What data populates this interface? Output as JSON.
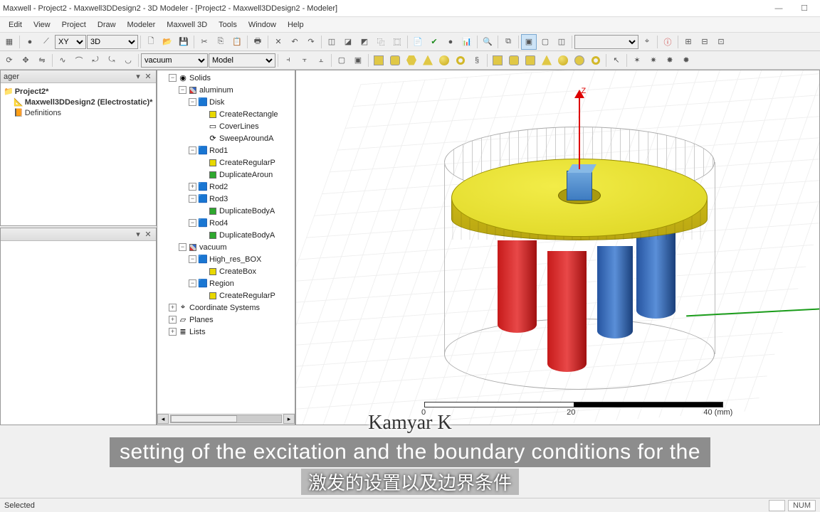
{
  "titlebar": {
    "text": "Maxwell  - Project2 - Maxwell3DDesign2 - 3D Modeler - [Project2 - Maxwell3DDesign2 - Modeler]"
  },
  "menu": {
    "items": [
      "Edit",
      "View",
      "Project",
      "Draw",
      "Modeler",
      "Maxwell 3D",
      "Tools",
      "Window",
      "Help"
    ]
  },
  "toolbar1": {
    "plane": "XY",
    "mode": "3D",
    "bgmat": "vacuum",
    "model_dd": "Model"
  },
  "project": {
    "panel_title": "ager",
    "root": "Project2*",
    "design": "Maxwell3DDesign2 (Electrostatic)*",
    "defs": "Definitions"
  },
  "tree": {
    "solids": "Solids",
    "mat1": "aluminum",
    "disk": "Disk",
    "disk_ops": [
      "CreateRectangle",
      "CoverLines",
      "SweepAroundA"
    ],
    "rod1": "Rod1",
    "rod1_ops": [
      "CreateRegularP",
      "DuplicateAroun"
    ],
    "rod2": "Rod2",
    "rod3": "Rod3",
    "rod3_op": "DuplicateBodyA",
    "rod4": "Rod4",
    "rod4_op": "DuplicateBodyA",
    "mat2": "vacuum",
    "hires": "High_res_BOX",
    "hires_op": "CreateBox",
    "region": "Region",
    "region_op": "CreateRegularP",
    "coordsys": "Coordinate Systems",
    "planes": "Planes",
    "lists": "Lists"
  },
  "viewport": {
    "z_label": "Z",
    "ruler": {
      "t0": "0",
      "t1": "20",
      "t2": "40 (mm)"
    }
  },
  "overlay": {
    "name": "Kamyar K",
    "line1": "setting of the excitation and the  boundary conditions for the",
    "line2": "激发的设置以及边界条件"
  },
  "status": {
    "left": "Selected",
    "num": "NUM"
  }
}
